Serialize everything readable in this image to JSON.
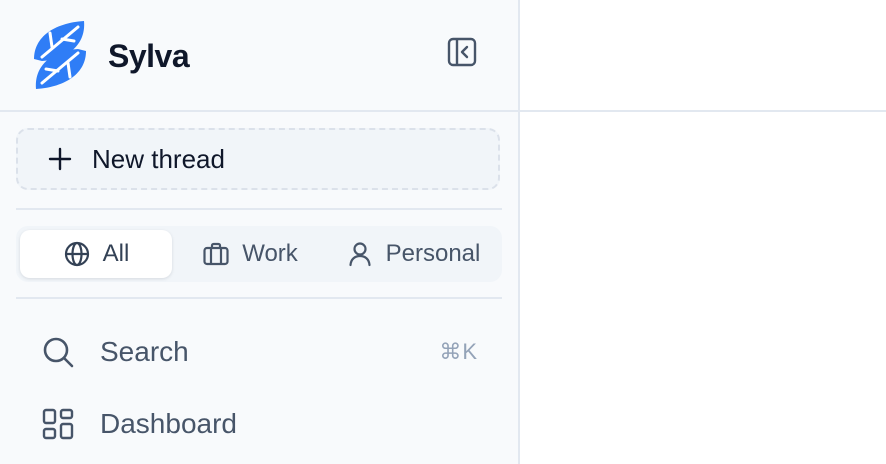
{
  "app": {
    "name": "Sylva",
    "brand_color": "#2f7df6"
  },
  "header": {
    "collapse_icon": "sidebar-collapse-icon"
  },
  "new_thread": {
    "label": "New thread",
    "icon": "plus-icon"
  },
  "filters": {
    "selected": "All",
    "items": [
      {
        "label": "All",
        "icon": "globe-icon"
      },
      {
        "label": "Work",
        "icon": "briefcase-icon"
      },
      {
        "label": "Personal",
        "icon": "user-icon"
      }
    ]
  },
  "nav": {
    "items": [
      {
        "label": "Search",
        "icon": "search-icon",
        "shortcut": "⌘K"
      },
      {
        "label": "Dashboard",
        "icon": "dashboard-grid-icon",
        "shortcut": ""
      }
    ]
  }
}
